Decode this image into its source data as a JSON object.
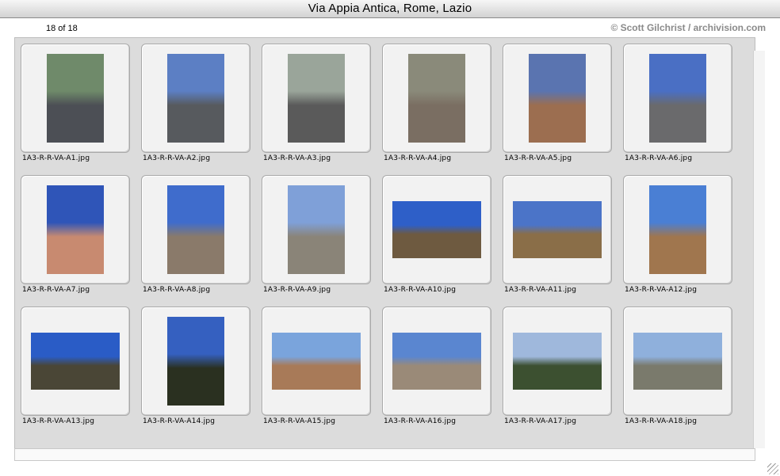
{
  "window": {
    "title": "Via Appia Antica, Rome, Lazio"
  },
  "gallery": {
    "count_label": "18 of 18",
    "credit": "© Scott Gilchrist / archivision.com"
  },
  "photos": [
    {
      "file": "1A3-R-R-VA-A1.jpg",
      "orientation": "p",
      "sky": "#6f8a6a",
      "ground": "#4c4f55"
    },
    {
      "file": "1A3-R-R-VA-A2.jpg",
      "orientation": "p",
      "sky": "#5c7fc4",
      "ground": "#575a5e"
    },
    {
      "file": "1A3-R-R-VA-A3.jpg",
      "orientation": "p",
      "sky": "#9aa59a",
      "ground": "#5a5a5a"
    },
    {
      "file": "1A3-R-R-VA-A4.jpg",
      "orientation": "p",
      "sky": "#8a8a7a",
      "ground": "#7a6e62"
    },
    {
      "file": "1A3-R-R-VA-A5.jpg",
      "orientation": "p",
      "sky": "#5a74b0",
      "ground": "#9c6e50"
    },
    {
      "file": "1A3-R-R-VA-A6.jpg",
      "orientation": "p",
      "sky": "#4a6fc4",
      "ground": "#6a6a6c"
    },
    {
      "file": "1A3-R-R-VA-A7.jpg",
      "orientation": "p",
      "sky": "#2f55b8",
      "ground": "#c88a70"
    },
    {
      "file": "1A3-R-R-VA-A8.jpg",
      "orientation": "p",
      "sky": "#3f6ccc",
      "ground": "#8a7a6a"
    },
    {
      "file": "1A3-R-R-VA-A9.jpg",
      "orientation": "p",
      "sky": "#7fa0d8",
      "ground": "#8a8478"
    },
    {
      "file": "1A3-R-R-VA-A10.jpg",
      "orientation": "l",
      "sky": "#2e5fc8",
      "ground": "#6e5a40"
    },
    {
      "file": "1A3-R-R-VA-A11.jpg",
      "orientation": "l",
      "sky": "#4b74c8",
      "ground": "#8a6e48"
    },
    {
      "file": "1A3-R-R-VA-A12.jpg",
      "orientation": "p",
      "sky": "#4a7fd4",
      "ground": "#a0764e"
    },
    {
      "file": "1A3-R-R-VA-A13.jpg",
      "orientation": "l",
      "sky": "#2a5cc6",
      "ground": "#4a4636"
    },
    {
      "file": "1A3-R-R-VA-A14.jpg",
      "orientation": "p",
      "sky": "#3560c0",
      "ground": "#2a3020"
    },
    {
      "file": "1A3-R-R-VA-A15.jpg",
      "orientation": "l",
      "sky": "#7aa4dc",
      "ground": "#a87a58"
    },
    {
      "file": "1A3-R-R-VA-A16.jpg",
      "orientation": "l",
      "sky": "#5a86d0",
      "ground": "#9a8a78"
    },
    {
      "file": "1A3-R-R-VA-A17.jpg",
      "orientation": "l",
      "sky": "#9fb8dc",
      "ground": "#3c5030"
    },
    {
      "file": "1A3-R-R-VA-A18.jpg",
      "orientation": "l",
      "sky": "#8fb0dc",
      "ground": "#7a7a6c"
    }
  ]
}
